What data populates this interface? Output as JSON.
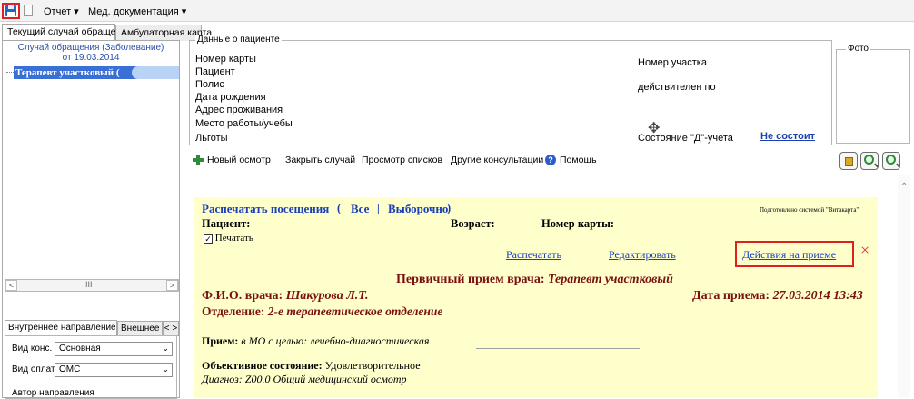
{
  "toolbar": {
    "menu_report": "Отчет ▾",
    "menu_med_docs": "Мед. документация ▾"
  },
  "main_tabs": {
    "current_case": "Текущий случай обращения",
    "outpatient_card": "Амбулаторная карта"
  },
  "case_tree": {
    "header_line1": "Случай обращения (Заболевание)",
    "header_line2": "от 19.03.2014",
    "selected_item": "Терапевт участковый (",
    "scroll_mid": "III"
  },
  "referral": {
    "tab_internal": "Внутреннее направление",
    "tab_external": "Внешнее на",
    "consult_type_label": "Вид конс.",
    "consult_type_value": "Основная",
    "payment_label": "Вид оплаты",
    "payment_value": "ОМС",
    "author_label": "Автор направления"
  },
  "patient": {
    "section_title": "Данные о пациенте",
    "card_number": "Номер карты",
    "patient": "Пациент",
    "policy": "Полис",
    "birth_date": "Дата рождения",
    "address": "Адрес проживания",
    "work_place": "Место работы/учебы",
    "benefits": "Льготы",
    "district_number": "Номер участка",
    "valid_until": "действителен по",
    "d_status": "Состояние \"Д\"-учета",
    "d_status_value": "Не состоит",
    "photo": "Фото"
  },
  "actions": {
    "new_exam": "Новый осмотр",
    "close_case": "Закрыть случай",
    "view_lists": "Просмотр списков",
    "other_consults": "Другие консультации",
    "help": "Помощь"
  },
  "document": {
    "print_visits": "Распечатать посещения",
    "open_paren": "(",
    "all": "Все",
    "sep": "|",
    "selective": "Выборочно",
    "close_paren": ")",
    "prepared_by": "Подготовлено системой \"Витакарта\"",
    "patient_label": "Пациент:",
    "age_label": "Возраст:",
    "card_label": "Номер карты:",
    "print_checkbox": "Печатать",
    "print_link": "Распечатать",
    "edit_link": "Редактировать",
    "actions_link": "Действия на приеме",
    "close_x": "×",
    "visit_title": "Первичный прием врача: ",
    "visit_specialty": "Терапевт участковый",
    "doctor_label": "Ф.И.О. врача: ",
    "doctor_name": "Шакурова Л.Т.",
    "date_label": "Дата приема: ",
    "date_value": "27.03.2014 13:43",
    "department_label": "Отделение: ",
    "department_value": "2-е терапевтическое отделение",
    "reception_label": "Прием: ",
    "reception_value": "в МО с целью: лечебно-диагностическая",
    "objective_label": "Объективное состояние: ",
    "objective_value": "Удовлетворительное",
    "diagnosis": "Диагноз: Z00.0 Общий медицинский осмотр"
  }
}
